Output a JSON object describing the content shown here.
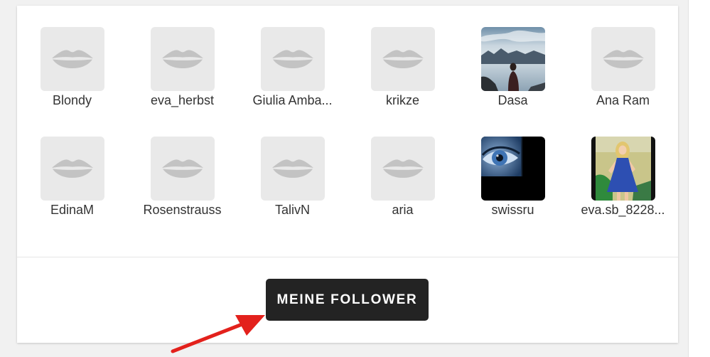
{
  "followers": [
    {
      "name": "Blondy",
      "avatar": "lips-icon"
    },
    {
      "name": "eva_herbst",
      "avatar": "lips-icon"
    },
    {
      "name": "Giulia Amba...",
      "avatar": "lips-icon"
    },
    {
      "name": "krikze",
      "avatar": "lips-icon"
    },
    {
      "name": "Dasa",
      "avatar": "photo"
    },
    {
      "name": "Ana Ram",
      "avatar": "lips-icon"
    },
    {
      "name": "EdinaM",
      "avatar": "lips-icon"
    },
    {
      "name": "Rosenstrauss",
      "avatar": "lips-icon"
    },
    {
      "name": "TalivN",
      "avatar": "lips-icon"
    },
    {
      "name": "aria",
      "avatar": "lips-icon"
    },
    {
      "name": "swissru",
      "avatar": "photo"
    },
    {
      "name": "eva.sb_8228...",
      "avatar": "photo"
    }
  ],
  "button": {
    "label": "MEINE FOLLOWER"
  },
  "annotation": {
    "icon": "red-arrow-icon"
  },
  "colors": {
    "page_bg": "#f1f1f1",
    "card_bg": "#ffffff",
    "button_bg": "#232323",
    "button_text": "#ffffff",
    "name_text": "#333333",
    "placeholder_bg": "#e9e9e9",
    "lips": "#c3c3c3",
    "arrow": "#e3211c"
  }
}
